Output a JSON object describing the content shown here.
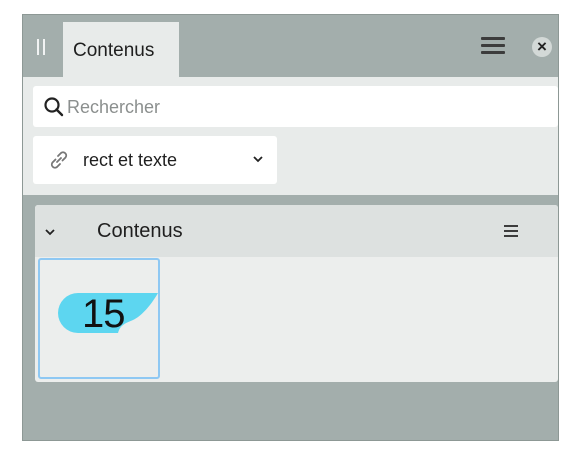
{
  "panel": {
    "tab_label": "Contenus"
  },
  "search": {
    "placeholder": "Rechercher"
  },
  "dropdown": {
    "value": "rect et texte"
  },
  "section": {
    "title": "Contenus",
    "items": [
      {
        "label": "15",
        "shape_color": "#5dd6f0"
      }
    ]
  },
  "icons": [
    "grip-icon",
    "menu-icon",
    "close-icon",
    "search-icon",
    "link-icon",
    "chevron-down-icon",
    "list-menu-icon"
  ],
  "colors": {
    "panel_bg": "#a3aeac",
    "content_bg": "#e8ebea",
    "selection_border": "#8ec8f3",
    "shape_fill": "#5dd6f0"
  }
}
